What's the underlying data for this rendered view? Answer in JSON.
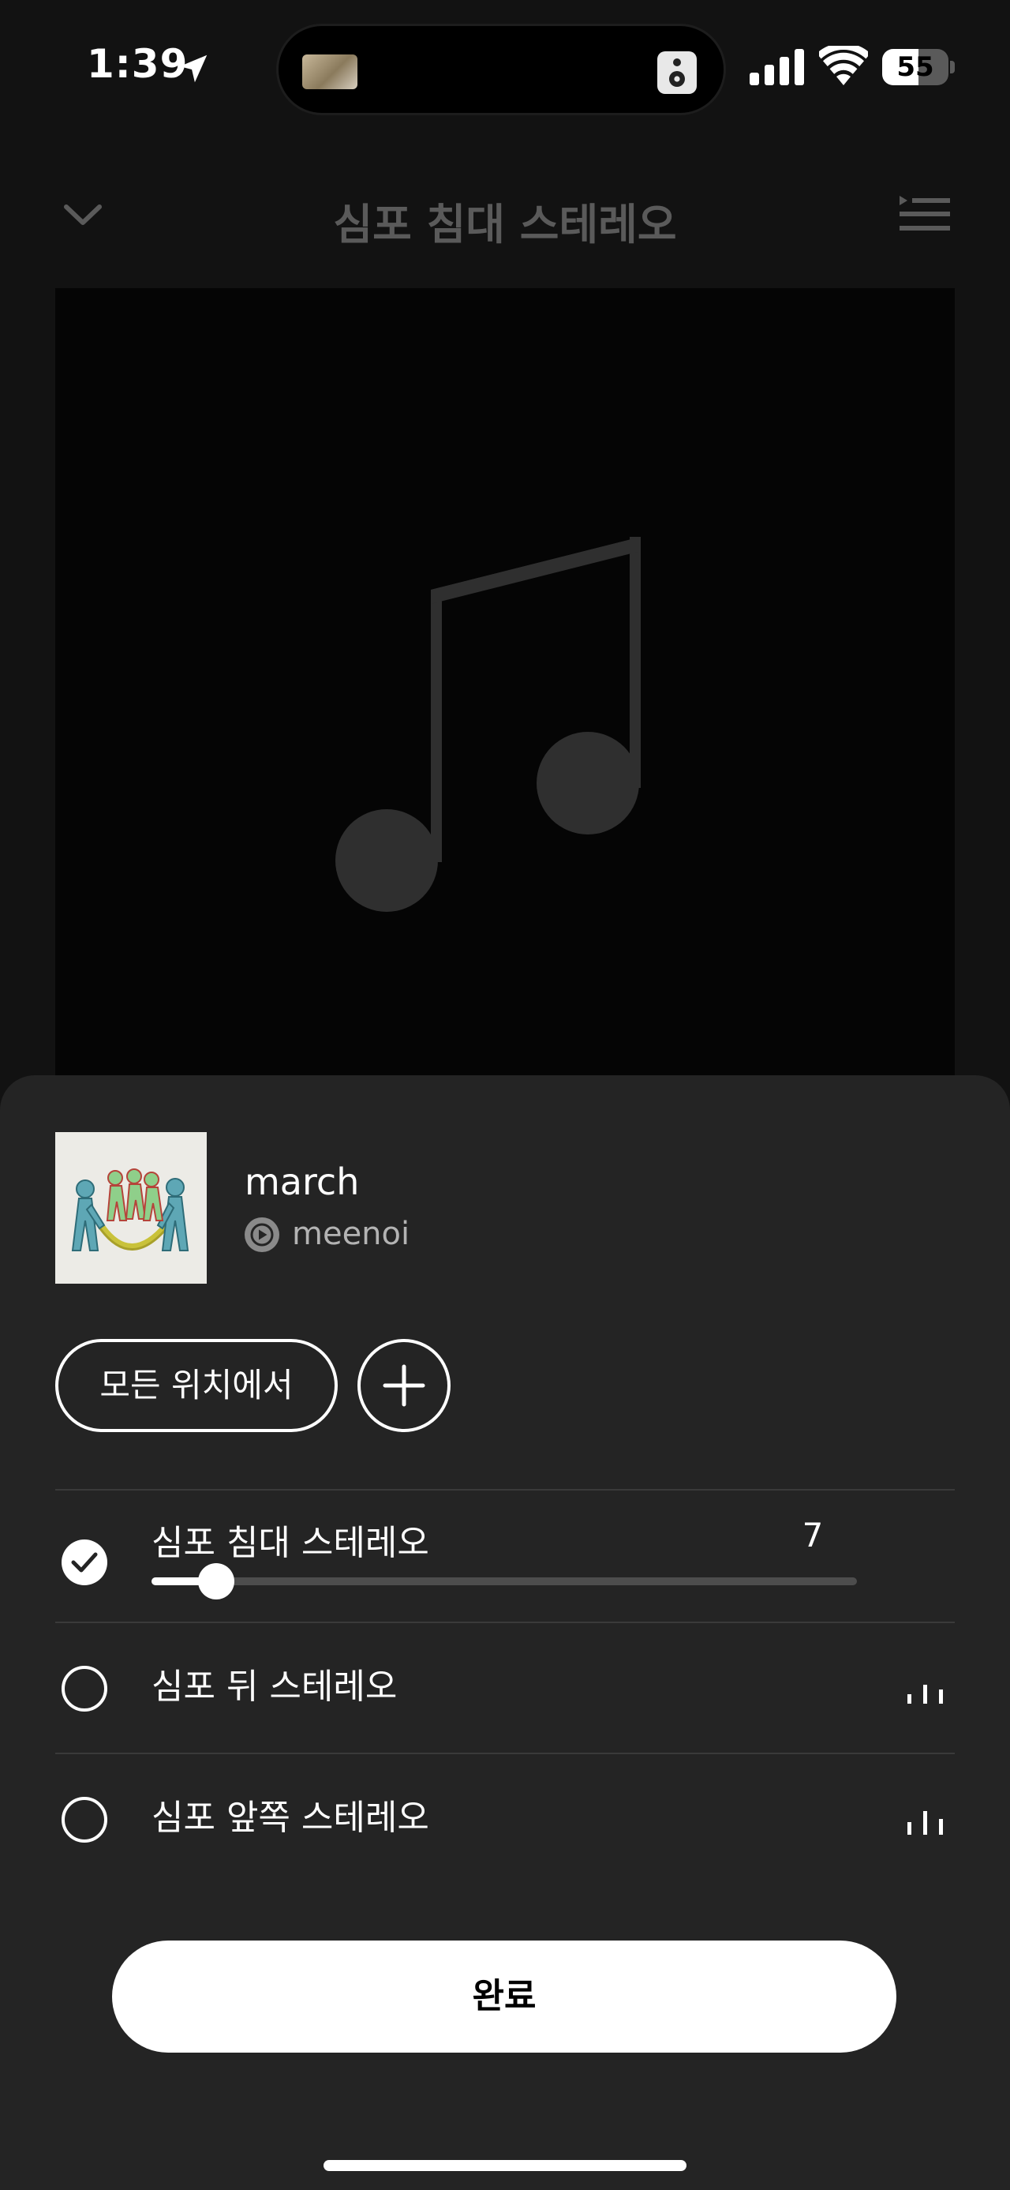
{
  "status_bar": {
    "time": "1:39",
    "battery_level": "55",
    "battery_fraction": 0.55
  },
  "header": {
    "title": "심포 침대 스테레오"
  },
  "now_playing": {
    "track_title": "march",
    "artist": "meenoi"
  },
  "controls": {
    "everywhere_label": "모든 위치에서"
  },
  "devices": [
    {
      "name": "심포 침대 스테레오",
      "selected": true,
      "volume": "7",
      "volume_fraction": 0.07
    },
    {
      "name": "심포 뒤 스테레오",
      "selected": false
    },
    {
      "name": "심포 앞쪽 스테레오",
      "selected": false
    }
  ],
  "done_label": "완료",
  "colors": {
    "background": "#121212",
    "sheet": "#242424",
    "text": "#ffffff",
    "secondary_text": "#b3b3b3",
    "track": "#4d4d4d"
  },
  "icons": {
    "status": [
      "location-arrow-icon",
      "speaker-icon",
      "cellular-signal-icon",
      "wifi-icon",
      "battery-icon"
    ],
    "header": [
      "chevron-down-icon",
      "queue-icon"
    ],
    "artwork": "music-note-icon",
    "artist": "artist-play-icon",
    "add": "plus-icon",
    "device_states": [
      "check-icon",
      "equalizer-icon"
    ]
  }
}
